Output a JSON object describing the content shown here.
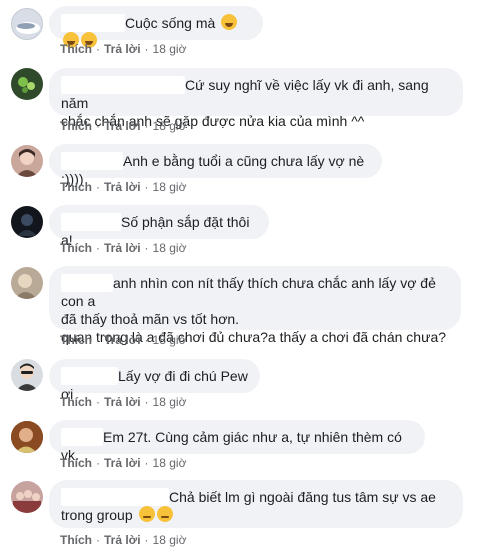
{
  "actions": {
    "like": "Thích",
    "reply": "Trả lời",
    "sep": "·",
    "time": "18 giờ"
  },
  "comments": [
    {
      "text": "Cuộc sống mà",
      "emoji": "rofl-emoji x3"
    },
    {
      "text": "Cứ suy nghĩ về việc lấy vk đi anh, sang năm\nchắc chắn anh sẽ gặp được nửa kia của mình ^^"
    },
    {
      "text": "Anh e bằng tuổi a cũng chưa lấy vợ nè :))))"
    },
    {
      "text": "Số phận sắp đặt thôi a!"
    },
    {
      "text": "anh nhìn con nít thấy thích chưa chắc anh lấy vợ đẻ con a\nđã thấy thoả mãn vs tốt hơn.\nquan trọng là a đã chơi đủ chưa?a thấy a chơi đã chán chưa?"
    },
    {
      "text": "Lấy vợ đi đi chú Pew ơi"
    },
    {
      "text": "Em 27t. Cùng cảm giác như a, tự nhiên thèm có vk."
    },
    {
      "text": "Chả biết lm gì ngoài đăng tus tâm sự vs ae\ntrong group",
      "emoji": "pensive-emoji x2"
    }
  ],
  "colors": {
    "bubble": "#f0f2f5",
    "text": "#1c1e21",
    "meta": "#65676b"
  }
}
